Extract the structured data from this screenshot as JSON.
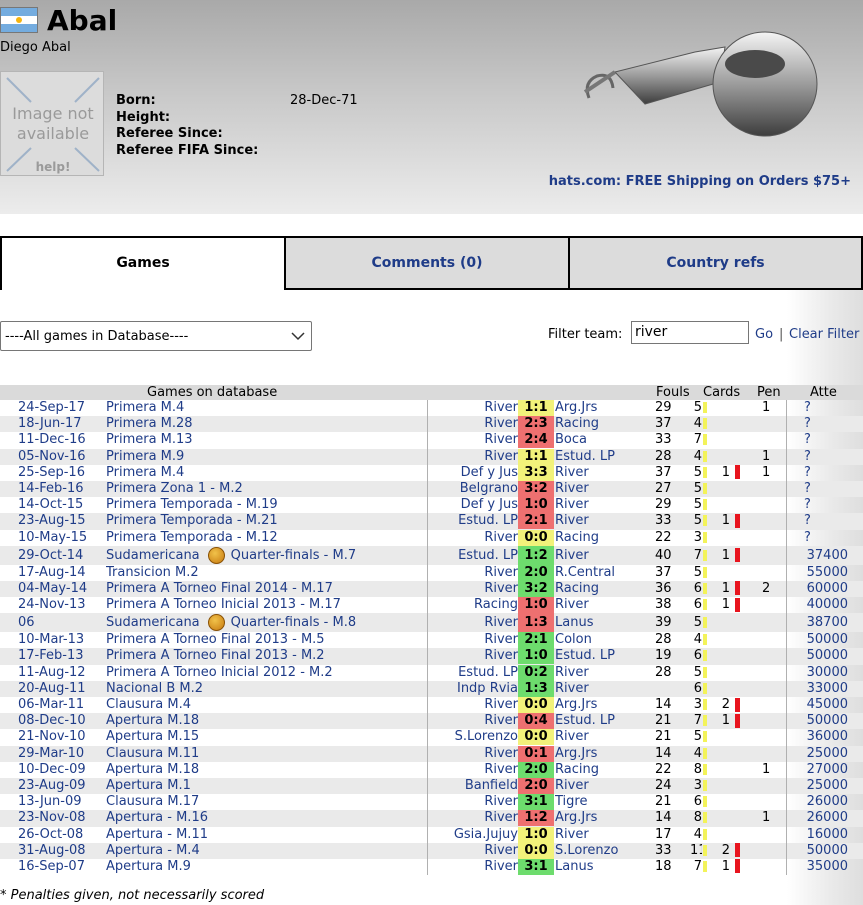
{
  "referee": {
    "short_name": "Abal",
    "full_name": "Diego Abal",
    "photo_text_1": "Image not",
    "photo_text_2": "available",
    "photo_help": "help!",
    "born_label": "Born:",
    "born_value": "28-Dec-71",
    "height_label": "Height:",
    "since_label": "Referee Since:",
    "fifa_label": "Referee FIFA Since:",
    "flag_colors": [
      "#74acdf",
      "#ffffff",
      "#f6b40e"
    ]
  },
  "promo": "hats.com: FREE Shipping on Orders $75+",
  "tabs": [
    "Games",
    "Comments (0)",
    "Country refs"
  ],
  "filter": {
    "select_value": "----All games in Database----",
    "label": "Filter team:",
    "input_value": "river",
    "go": "Go",
    "sep": "|",
    "clear": "Clear Filter"
  },
  "table_headers": {
    "games": "Games on database",
    "fouls": "Fouls",
    "cards": "Cards",
    "pen": "Pen",
    "att": "Atte"
  },
  "games": [
    {
      "date": "24-Sep-17",
      "comp": "Primera M.4",
      "home": "River",
      "score": "1:1",
      "res": "w",
      "away": "Arg.Jrs",
      "fouls": "29",
      "yel": "5",
      "red": "",
      "pen": "1",
      "att": "?"
    },
    {
      "date": "18-Jun-17",
      "comp": "Primera M.28",
      "home": "River",
      "score": "2:3",
      "res": "r",
      "away": "Racing",
      "fouls": "37",
      "yel": "4",
      "red": "",
      "pen": "",
      "att": "?"
    },
    {
      "date": "11-Dec-16",
      "comp": "Primera M.13",
      "home": "River",
      "score": "2:4",
      "res": "r",
      "away": "Boca",
      "fouls": "33",
      "yel": "7",
      "red": "",
      "pen": "",
      "att": "?"
    },
    {
      "date": "05-Nov-16",
      "comp": "Primera M.9",
      "home": "River",
      "score": "1:1",
      "res": "w",
      "away": "Estud. LP",
      "fouls": "28",
      "yel": "4",
      "red": "",
      "pen": "1",
      "att": "?"
    },
    {
      "date": "25-Sep-16",
      "comp": "Primera M.4",
      "home": "Def y Jus",
      "score": "3:3",
      "res": "w",
      "away": "River",
      "fouls": "37",
      "yel": "5",
      "red": "1",
      "pen": "1",
      "att": "?"
    },
    {
      "date": "14-Feb-16",
      "comp": "Primera Zona 1 - M.2",
      "home": "Belgrano",
      "score": "3:2",
      "res": "r",
      "away": "River",
      "fouls": "27",
      "yel": "5",
      "red": "",
      "pen": "",
      "att": "?"
    },
    {
      "date": "14-Oct-15",
      "comp": "Primera Temporada - M.19",
      "home": "Def y Jus",
      "score": "1:0",
      "res": "r",
      "away": "River",
      "fouls": "29",
      "yel": "5",
      "red": "",
      "pen": "",
      "att": "?"
    },
    {
      "date": "23-Aug-15",
      "comp": "Primera Temporada - M.21",
      "home": "Estud. LP",
      "score": "2:1",
      "res": "r",
      "away": "River",
      "fouls": "33",
      "yel": "5",
      "red": "1",
      "pen": "",
      "att": "?"
    },
    {
      "date": "10-May-15",
      "comp": "Primera Temporada - M.12",
      "home": "River",
      "score": "0:0",
      "res": "w",
      "away": "Racing",
      "fouls": "22",
      "yel": "3",
      "red": "",
      "pen": "",
      "att": "?"
    },
    {
      "date": "29-Oct-14",
      "comp": "Sudamericana",
      "comp2": "Quarter-finals - M.7",
      "ball": true,
      "home": "Estud. LP",
      "score": "1:2",
      "res": "g",
      "away": "River",
      "fouls": "40",
      "yel": "7",
      "red": "1",
      "pen": "",
      "att": "37400"
    },
    {
      "date": "17-Aug-14",
      "comp": "Transicion M.2",
      "home": "River",
      "score": "2:0",
      "res": "g",
      "away": "R.Central",
      "fouls": "37",
      "yel": "5",
      "red": "",
      "pen": "",
      "att": "55000"
    },
    {
      "date": "04-May-14",
      "comp": "Primera A Torneo Final 2014 - M.17",
      "home": "River",
      "score": "3:2",
      "res": "g",
      "away": "Racing",
      "fouls": "36",
      "yel": "6",
      "red": "1",
      "pen": "2",
      "att": "60000"
    },
    {
      "date": "24-Nov-13",
      "comp": "Primera A Torneo Inicial 2013 - M.17",
      "home": "Racing",
      "score": "1:0",
      "res": "r",
      "away": "River",
      "fouls": "38",
      "yel": "6",
      "red": "1",
      "pen": "",
      "att": "40000"
    },
    {
      "date": "06",
      "comp": "Sudamericana",
      "comp2": "Quarter-finals - M.8",
      "ball": true,
      "home": "River",
      "score": "1:3",
      "res": "r",
      "away": "Lanus",
      "fouls": "39",
      "yel": "5",
      "red": "",
      "pen": "",
      "att": "38700"
    },
    {
      "date": "10-Mar-13",
      "comp": "Primera A Torneo Final 2013 - M.5",
      "home": "River",
      "score": "2:1",
      "res": "g",
      "away": "Colon",
      "fouls": "28",
      "yel": "4",
      "red": "",
      "pen": "",
      "att": "50000"
    },
    {
      "date": "17-Feb-13",
      "comp": "Primera A Torneo Final 2013 - M.2",
      "home": "River",
      "score": "1:0",
      "res": "g",
      "away": "Estud. LP",
      "fouls": "19",
      "yel": "6",
      "red": "",
      "pen": "",
      "att": "50000"
    },
    {
      "date": "11-Aug-12",
      "comp": "Primera A Torneo Inicial 2012 - M.2",
      "home": "Estud. LP",
      "score": "0:2",
      "res": "g",
      "away": "River",
      "fouls": "28",
      "yel": "5",
      "red": "",
      "pen": "",
      "att": "30000"
    },
    {
      "date": "20-Aug-11",
      "comp": "Nacional B M.2",
      "home": "Indp Rvia",
      "score": "1:3",
      "res": "g",
      "away": "River",
      "fouls": "",
      "yel": "6",
      "red": "",
      "pen": "",
      "att": "33000"
    },
    {
      "date": "06-Mar-11",
      "comp": "Clausura M.4",
      "home": "River",
      "score": "0:0",
      "res": "w",
      "away": "Arg.Jrs",
      "fouls": "14",
      "yel": "3",
      "red": "2",
      "pen": "",
      "att": "45000"
    },
    {
      "date": "08-Dec-10",
      "comp": "Apertura M.18",
      "home": "River",
      "score": "0:4",
      "res": "r",
      "away": "Estud. LP",
      "fouls": "21",
      "yel": "7",
      "red": "1",
      "pen": "",
      "att": "50000"
    },
    {
      "date": "21-Nov-10",
      "comp": "Apertura M.15",
      "home": "S.Lorenzo",
      "score": "0:0",
      "res": "w",
      "away": "River",
      "fouls": "21",
      "yel": "5",
      "red": "",
      "pen": "",
      "att": "36000"
    },
    {
      "date": "29-Mar-10",
      "comp": "Clausura M.11",
      "home": "River",
      "score": "0:1",
      "res": "r",
      "away": "Arg.Jrs",
      "fouls": "14",
      "yel": "4",
      "red": "",
      "pen": "",
      "att": "25000"
    },
    {
      "date": "10-Dec-09",
      "comp": "Apertura M.18",
      "home": "River",
      "score": "2:0",
      "res": "g",
      "away": "Racing",
      "fouls": "22",
      "yel": "8",
      "red": "",
      "pen": "1",
      "att": "27000"
    },
    {
      "date": "23-Aug-09",
      "comp": "Apertura M.1",
      "home": "Banfield",
      "score": "2:0",
      "res": "r",
      "away": "River",
      "fouls": "24",
      "yel": "3",
      "red": "",
      "pen": "",
      "att": "25000"
    },
    {
      "date": "13-Jun-09",
      "comp": "Clausura M.17",
      "home": "River",
      "score": "3:1",
      "res": "g",
      "away": "Tigre",
      "fouls": "21",
      "yel": "6",
      "red": "",
      "pen": "",
      "att": "26000"
    },
    {
      "date": "23-Nov-08",
      "comp": "Apertura - M.16",
      "home": "River",
      "score": "1:2",
      "res": "r",
      "away": "Arg.Jrs",
      "fouls": "14",
      "yel": "8",
      "red": "",
      "pen": "1",
      "att": "26000"
    },
    {
      "date": "26-Oct-08",
      "comp": "Apertura - M.11",
      "home": "Gsia.Jujuy",
      "score": "1:0",
      "res": "w",
      "away": "River",
      "fouls": "17",
      "yel": "4",
      "red": "",
      "pen": "",
      "att": "16000"
    },
    {
      "date": "31-Aug-08",
      "comp": "Apertura - M.4",
      "home": "River",
      "score": "0:0",
      "res": "w",
      "away": "S.Lorenzo",
      "fouls": "33",
      "yel": "11",
      "red": "2",
      "pen": "",
      "att": "50000"
    },
    {
      "date": "16-Sep-07",
      "comp": "Apertura M.9",
      "home": "River",
      "score": "3:1",
      "res": "g",
      "away": "Lanus",
      "fouls": "18",
      "yel": "7",
      "red": "1",
      "pen": "",
      "att": "35000"
    }
  ],
  "footnote": "* Penalties given, not necessarily scored",
  "colors": {
    "win": "#6ddc6d",
    "draw": "#f2f27a",
    "loss": "#ee7070",
    "link": "#1f3c88"
  }
}
